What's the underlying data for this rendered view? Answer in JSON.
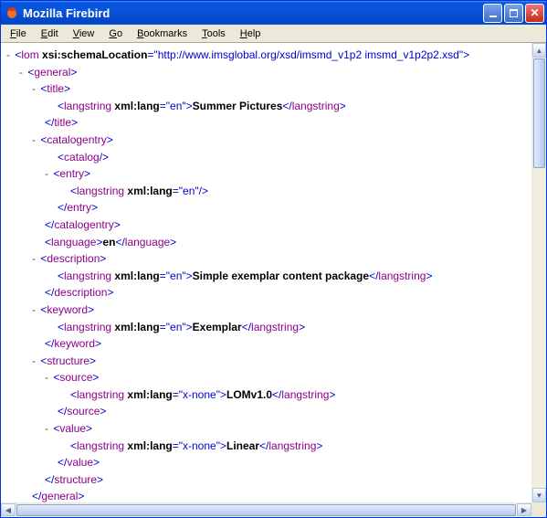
{
  "window": {
    "title": "Mozilla Firebird"
  },
  "menu": {
    "file": "File",
    "edit": "Edit",
    "view": "View",
    "go": "Go",
    "bookmarks": "Bookmarks",
    "tools": "Tools",
    "help": "Help"
  },
  "xml": {
    "root_tag": "lom",
    "root_attr_name": "xsi:schemaLocation",
    "root_attr_value": "http://www.imsglobal.org/xsd/imsmd_v1p2 imsmd_v1p2p2.xsd",
    "general_open": "general",
    "title_tag": "title",
    "langstring_tag": "langstring",
    "xml_lang_attr": "xml:lang",
    "lang_en": "en",
    "lang_x_none": "x-none",
    "title_text": "Summer Pictures",
    "catalogentry_tag": "catalogentry",
    "catalog_tag": "catalog",
    "entry_tag": "entry",
    "language_tag": "language",
    "language_text": "en",
    "description_tag": "description",
    "description_text": "Simple exemplar content package",
    "keyword_tag": "keyword",
    "keyword_text": "Exemplar",
    "structure_tag": "structure",
    "source_tag": "source",
    "source_text": "LOMv1.0",
    "value_tag": "value",
    "value_text": "Linear"
  }
}
